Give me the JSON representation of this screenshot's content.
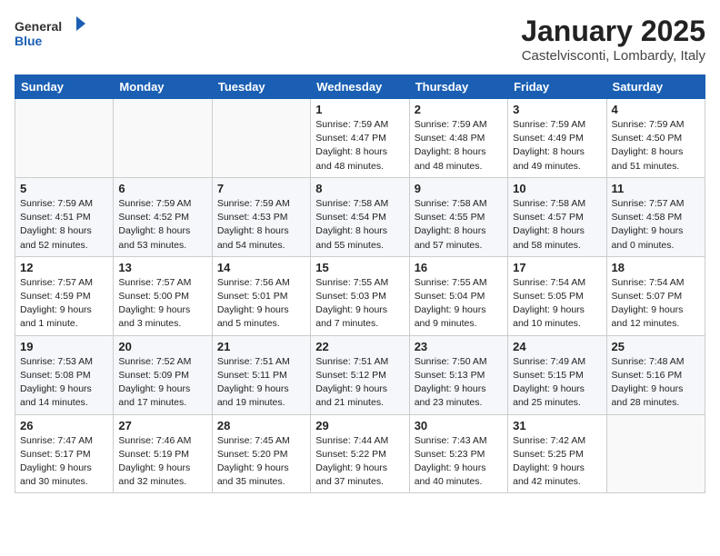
{
  "header": {
    "logo_line1": "General",
    "logo_line2": "Blue",
    "month": "January 2025",
    "location": "Castelvisconti, Lombardy, Italy"
  },
  "weekdays": [
    "Sunday",
    "Monday",
    "Tuesday",
    "Wednesday",
    "Thursday",
    "Friday",
    "Saturday"
  ],
  "weeks": [
    [
      {
        "day": "",
        "content": ""
      },
      {
        "day": "",
        "content": ""
      },
      {
        "day": "",
        "content": ""
      },
      {
        "day": "1",
        "content": "Sunrise: 7:59 AM\nSunset: 4:47 PM\nDaylight: 8 hours\nand 48 minutes."
      },
      {
        "day": "2",
        "content": "Sunrise: 7:59 AM\nSunset: 4:48 PM\nDaylight: 8 hours\nand 48 minutes."
      },
      {
        "day": "3",
        "content": "Sunrise: 7:59 AM\nSunset: 4:49 PM\nDaylight: 8 hours\nand 49 minutes."
      },
      {
        "day": "4",
        "content": "Sunrise: 7:59 AM\nSunset: 4:50 PM\nDaylight: 8 hours\nand 51 minutes."
      }
    ],
    [
      {
        "day": "5",
        "content": "Sunrise: 7:59 AM\nSunset: 4:51 PM\nDaylight: 8 hours\nand 52 minutes."
      },
      {
        "day": "6",
        "content": "Sunrise: 7:59 AM\nSunset: 4:52 PM\nDaylight: 8 hours\nand 53 minutes."
      },
      {
        "day": "7",
        "content": "Sunrise: 7:59 AM\nSunset: 4:53 PM\nDaylight: 8 hours\nand 54 minutes."
      },
      {
        "day": "8",
        "content": "Sunrise: 7:58 AM\nSunset: 4:54 PM\nDaylight: 8 hours\nand 55 minutes."
      },
      {
        "day": "9",
        "content": "Sunrise: 7:58 AM\nSunset: 4:55 PM\nDaylight: 8 hours\nand 57 minutes."
      },
      {
        "day": "10",
        "content": "Sunrise: 7:58 AM\nSunset: 4:57 PM\nDaylight: 8 hours\nand 58 minutes."
      },
      {
        "day": "11",
        "content": "Sunrise: 7:57 AM\nSunset: 4:58 PM\nDaylight: 9 hours\nand 0 minutes."
      }
    ],
    [
      {
        "day": "12",
        "content": "Sunrise: 7:57 AM\nSunset: 4:59 PM\nDaylight: 9 hours\nand 1 minute."
      },
      {
        "day": "13",
        "content": "Sunrise: 7:57 AM\nSunset: 5:00 PM\nDaylight: 9 hours\nand 3 minutes."
      },
      {
        "day": "14",
        "content": "Sunrise: 7:56 AM\nSunset: 5:01 PM\nDaylight: 9 hours\nand 5 minutes."
      },
      {
        "day": "15",
        "content": "Sunrise: 7:55 AM\nSunset: 5:03 PM\nDaylight: 9 hours\nand 7 minutes."
      },
      {
        "day": "16",
        "content": "Sunrise: 7:55 AM\nSunset: 5:04 PM\nDaylight: 9 hours\nand 9 minutes."
      },
      {
        "day": "17",
        "content": "Sunrise: 7:54 AM\nSunset: 5:05 PM\nDaylight: 9 hours\nand 10 minutes."
      },
      {
        "day": "18",
        "content": "Sunrise: 7:54 AM\nSunset: 5:07 PM\nDaylight: 9 hours\nand 12 minutes."
      }
    ],
    [
      {
        "day": "19",
        "content": "Sunrise: 7:53 AM\nSunset: 5:08 PM\nDaylight: 9 hours\nand 14 minutes."
      },
      {
        "day": "20",
        "content": "Sunrise: 7:52 AM\nSunset: 5:09 PM\nDaylight: 9 hours\nand 17 minutes."
      },
      {
        "day": "21",
        "content": "Sunrise: 7:51 AM\nSunset: 5:11 PM\nDaylight: 9 hours\nand 19 minutes."
      },
      {
        "day": "22",
        "content": "Sunrise: 7:51 AM\nSunset: 5:12 PM\nDaylight: 9 hours\nand 21 minutes."
      },
      {
        "day": "23",
        "content": "Sunrise: 7:50 AM\nSunset: 5:13 PM\nDaylight: 9 hours\nand 23 minutes."
      },
      {
        "day": "24",
        "content": "Sunrise: 7:49 AM\nSunset: 5:15 PM\nDaylight: 9 hours\nand 25 minutes."
      },
      {
        "day": "25",
        "content": "Sunrise: 7:48 AM\nSunset: 5:16 PM\nDaylight: 9 hours\nand 28 minutes."
      }
    ],
    [
      {
        "day": "26",
        "content": "Sunrise: 7:47 AM\nSunset: 5:17 PM\nDaylight: 9 hours\nand 30 minutes."
      },
      {
        "day": "27",
        "content": "Sunrise: 7:46 AM\nSunset: 5:19 PM\nDaylight: 9 hours\nand 32 minutes."
      },
      {
        "day": "28",
        "content": "Sunrise: 7:45 AM\nSunset: 5:20 PM\nDaylight: 9 hours\nand 35 minutes."
      },
      {
        "day": "29",
        "content": "Sunrise: 7:44 AM\nSunset: 5:22 PM\nDaylight: 9 hours\nand 37 minutes."
      },
      {
        "day": "30",
        "content": "Sunrise: 7:43 AM\nSunset: 5:23 PM\nDaylight: 9 hours\nand 40 minutes."
      },
      {
        "day": "31",
        "content": "Sunrise: 7:42 AM\nSunset: 5:25 PM\nDaylight: 9 hours\nand 42 minutes."
      },
      {
        "day": "",
        "content": ""
      }
    ]
  ]
}
